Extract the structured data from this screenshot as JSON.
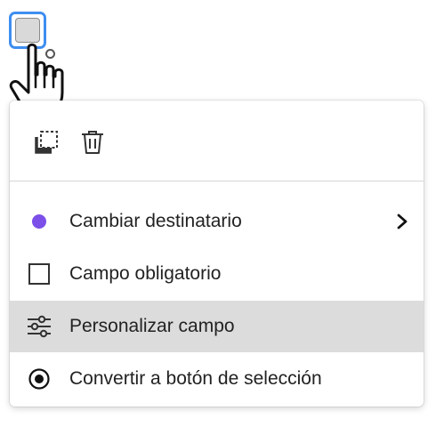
{
  "menu": {
    "tools": {
      "select_icon": "selection-icon",
      "delete_icon": "trash-icon"
    },
    "items": [
      {
        "label": "Cambiar destinatario",
        "icon": "purple-dot-icon",
        "submenu": true
      },
      {
        "label": "Campo obligatorio",
        "icon": "checkbox-icon"
      },
      {
        "label": "Personalizar campo",
        "icon": "sliders-icon",
        "highlighted": true
      },
      {
        "label": "Convertir a botón de selección",
        "icon": "radio-button-icon"
      }
    ]
  },
  "colors": {
    "recipient": "#7b4fe8",
    "selection_border": "#3f8ef0",
    "highlight": "#dcdcdc"
  }
}
